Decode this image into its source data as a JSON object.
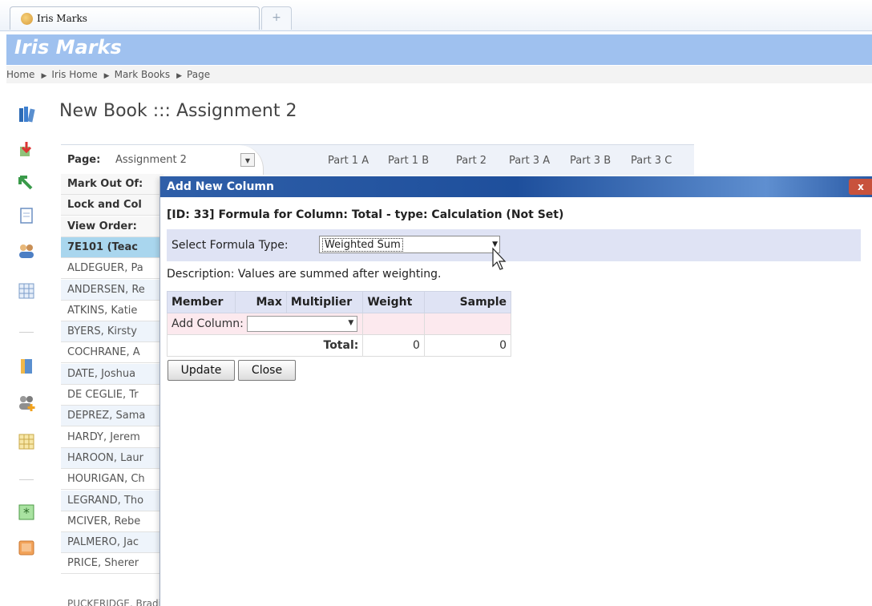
{
  "browser": {
    "tab_title": "Iris Marks",
    "new_tab_symbol": "+"
  },
  "app": {
    "title": "Iris Marks"
  },
  "breadcrumb": [
    "Home",
    "Iris Home",
    "Mark Books",
    "Page"
  ],
  "page_title": "New Book ::: Assignment 2",
  "grid": {
    "page_label": "Page:",
    "page_value": "Assignment 2",
    "columns": [
      "Part 1 A",
      "Part 1 B",
      "Part 2",
      "Part 3 A",
      "Part 3 B",
      "Part 3 C"
    ],
    "rows": [
      {
        "label": "Mark Out Of:",
        "kind": "bold"
      },
      {
        "label": "Lock and Col",
        "kind": "bold"
      },
      {
        "label": "View Order:",
        "kind": "bold"
      },
      {
        "label": "7E101 (Teac",
        "kind": "group"
      },
      {
        "label": "ALDEGUER, Pa",
        "kind": "plain"
      },
      {
        "label": "ANDERSEN, Re",
        "kind": "alt"
      },
      {
        "label": "ATKINS, Katie",
        "kind": "plain"
      },
      {
        "label": "BYERS, Kirsty",
        "kind": "alt"
      },
      {
        "label": "COCHRANE, A",
        "kind": "plain"
      },
      {
        "label": "DATE, Joshua",
        "kind": "alt"
      },
      {
        "label": "DE CEGLIE, Tr",
        "kind": "plain"
      },
      {
        "label": "DEPREZ, Sama",
        "kind": "alt"
      },
      {
        "label": "HARDY, Jerem",
        "kind": "plain"
      },
      {
        "label": "HAROON, Laur",
        "kind": "alt"
      },
      {
        "label": "HOURIGAN, Ch",
        "kind": "plain"
      },
      {
        "label": "LEGRAND, Tho",
        "kind": "alt"
      },
      {
        "label": "MCIVER, Rebe",
        "kind": "plain"
      },
      {
        "label": "PALMERO, Jac",
        "kind": "alt"
      },
      {
        "label": "PRICE, Sherer",
        "kind": "plain"
      }
    ],
    "bottom_row_label": "PUCKERIDGE, Bradie"
  },
  "dialog": {
    "title": "Add New Column",
    "close_label": "x",
    "heading": "[ID: 33] Formula for Column: Total - type: Calculation (Not Set)",
    "formula_type_label": "Select Formula Type:",
    "formula_type_value": "Weighted Sum",
    "description": "Description: Values are summed after weighting.",
    "table": {
      "headers": [
        "Member",
        "Max",
        "Multiplier",
        "Weight",
        "Sample"
      ],
      "add_column_label": "Add Column:",
      "add_column_value": "",
      "total_label": "Total:",
      "total_weight": "0",
      "total_sample": "0"
    },
    "update_label": "Update",
    "close_button_label": "Close"
  }
}
